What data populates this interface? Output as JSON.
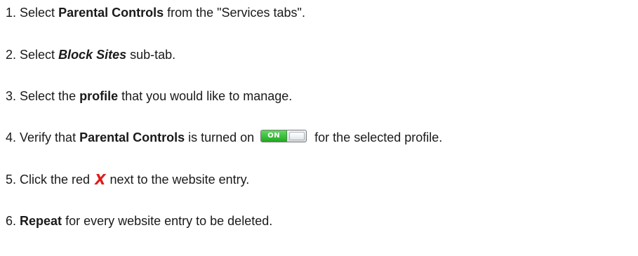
{
  "steps": [
    {
      "number": "1.",
      "parts": [
        "Select ",
        "Parental Controls",
        " from the \"Services tabs\"."
      ]
    },
    {
      "number": "2.",
      "parts": [
        "Select ",
        "Block Sites",
        " sub-tab."
      ]
    },
    {
      "number": "3.",
      "parts": [
        "Select the ",
        "profile",
        " that you would like to manage."
      ]
    },
    {
      "number": "4.",
      "parts": [
        "Verify that ",
        "Parental Controls",
        " is turned on ",
        " for the selected profile."
      ],
      "toggle_label": "ON"
    },
    {
      "number": "5.",
      "parts": [
        "Click the red ",
        " next to the website entry."
      ],
      "x_glyph": "X"
    },
    {
      "number": "6.",
      "parts": [
        "Repeat",
        " for every website entry to be deleted."
      ]
    }
  ],
  "colors": {
    "text": "#1a1a1a",
    "toggle_on": "#22a822",
    "delete_x": "#e01b1b"
  },
  "icons": {
    "toggle": "on-off-toggle-icon",
    "delete": "red-x-delete-icon"
  }
}
